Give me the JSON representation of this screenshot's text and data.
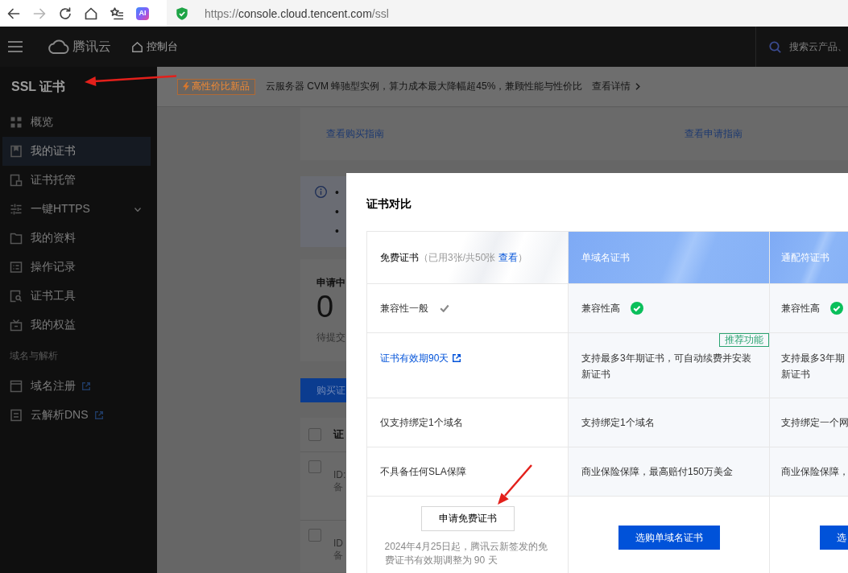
{
  "browser": {
    "ai_badge": "AI",
    "url": {
      "scheme": "https://",
      "host": "console.cloud.tencent.com",
      "path": "/ssl"
    }
  },
  "topbar": {
    "brand": "腾讯云",
    "console_link": "控制台",
    "search": {
      "placeholder": "搜索云产品、"
    }
  },
  "sidebar": {
    "title": "SSL 证书",
    "groups": [
      {
        "items": [
          {
            "label": "概览",
            "kind": "page",
            "selected": false
          },
          {
            "label": "我的证书",
            "kind": "page",
            "selected": true
          },
          {
            "label": "证书托管",
            "kind": "page",
            "selected": false
          },
          {
            "label": "一键HTTPS",
            "kind": "group",
            "selected": false,
            "expanded": false
          },
          {
            "label": "我的资料",
            "kind": "page",
            "selected": false
          },
          {
            "label": "操作记录",
            "kind": "page",
            "selected": false
          },
          {
            "label": "证书工具",
            "kind": "page",
            "selected": false
          },
          {
            "label": "我的权益",
            "kind": "page",
            "selected": false
          }
        ]
      },
      {
        "heading": "域名与解析",
        "items": [
          {
            "label": "域名注册",
            "kind": "external",
            "selected": false
          },
          {
            "label": "云解析DNS",
            "kind": "external",
            "selected": false
          }
        ]
      }
    ]
  },
  "banner": {
    "tag": "高性价比新品",
    "text": "云服务器 CVM 蜂驰型实例，算力成本最大降幅超45%，兼顾性能与性价比",
    "link": "查看详情"
  },
  "guides": [
    "查看购买指南",
    "查看申请指南"
  ],
  "notice": {
    "bullets": [
      "•",
      "•",
      "•"
    ]
  },
  "stats": {
    "title": "申请中",
    "value": "0",
    "caption": "待提交"
  },
  "buy_button": "购买证",
  "cert_list": {
    "header": {
      "label": "证",
      "checked": false
    },
    "rows": [
      {
        "id": "ID:",
        "note": "备",
        "checked": false
      },
      {
        "id": "ID",
        "note": "备",
        "checked": false
      }
    ]
  },
  "modal": {
    "title": "证书对比",
    "columns": [
      {
        "kind": "free",
        "name": "免费证书",
        "usage_before": "（已用3张/共50张 ",
        "usage_link": "查看",
        "usage_after": "）"
      },
      {
        "kind": "paid",
        "name": "单域名证书"
      },
      {
        "kind": "paid",
        "name": "通配符证书"
      }
    ],
    "rows": [
      {
        "kind": "single",
        "cells": [
          {
            "kind": "text",
            "text": "兼容性一般",
            "high_compatibility": false
          },
          {
            "kind": "text",
            "text": "兼容性高",
            "high_compatibility": true
          },
          {
            "kind": "text",
            "text": "兼容性高",
            "high_compatibility": true
          }
        ]
      },
      {
        "kind": "multi",
        "cells": [
          {
            "kind": "link",
            "text": "证书有效期90天"
          },
          {
            "kind": "text",
            "text": "支持最多3年期证书，可自动续费并安装新证书",
            "tag": "推荐功能"
          },
          {
            "kind": "lines",
            "lines": [
              "支持最多3年期",
              "新证书"
            ]
          }
        ]
      },
      {
        "kind": "single",
        "cells": [
          {
            "kind": "text",
            "text": "仅支持绑定1个域名"
          },
          {
            "kind": "text",
            "text": "支持绑定1个域名"
          },
          {
            "kind": "text",
            "text": "支持绑定一个网"
          }
        ]
      },
      {
        "kind": "single",
        "cells": [
          {
            "kind": "text",
            "text": "不具备任何SLA保障"
          },
          {
            "kind": "text",
            "text": "商业保险保障，最高赔付150万美金"
          },
          {
            "kind": "text",
            "text": "商业保险保障，"
          }
        ]
      },
      {
        "kind": "actions",
        "cells": [
          {
            "kind": "outline-button",
            "label": "申请免费证书",
            "note": "2024年4月25日起，腾讯云新签发的免费证书有效期调整为 90 天"
          },
          {
            "kind": "primary-button",
            "label": "选购单域名证书"
          },
          {
            "kind": "primary-button",
            "label": "选"
          }
        ]
      }
    ]
  }
}
